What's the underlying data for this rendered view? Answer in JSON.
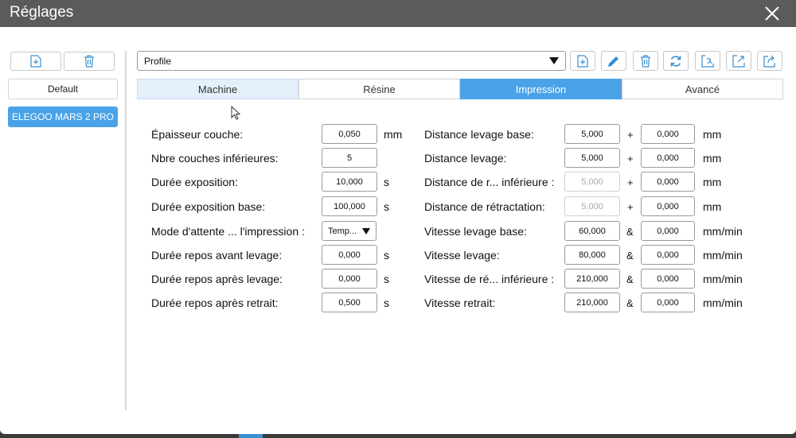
{
  "window": {
    "title": "Réglages"
  },
  "sidebar": {
    "profiles": [
      "Default",
      "ELEGOO MARS 2 PRO"
    ],
    "selected_index": 1
  },
  "toolbar": {
    "profile_value": "Profile",
    "icons": [
      "add-file-icon",
      "pencil-icon",
      "trash-icon",
      "refresh-icon",
      "import-icon",
      "export-icon",
      "export-alt-icon"
    ]
  },
  "tabs": [
    {
      "label": "Machine",
      "state": "hover"
    },
    {
      "label": "Résine",
      "state": "normal"
    },
    {
      "label": "Impression",
      "state": "active"
    },
    {
      "label": "Avancé",
      "state": "normal"
    }
  ],
  "left_form": {
    "layer_height": {
      "label": "Épaisseur couche:",
      "value": "0,050",
      "unit": "mm"
    },
    "bottom_layers": {
      "label": "Nbre couches inférieures:",
      "value": "5"
    },
    "exposure": {
      "label": "Durée exposition:",
      "value": "10,000",
      "unit": "s"
    },
    "bottom_exposure": {
      "label": "Durée exposition base:",
      "value": "100,000",
      "unit": "s"
    },
    "wait_mode": {
      "label": "Mode d'attente ... l'impression :",
      "value": "Temp..."
    },
    "wait_before_lift": {
      "label": "Durée repos avant levage:",
      "value": "0,000",
      "unit": "s"
    },
    "wait_after_lift": {
      "label": "Durée repos après levage:",
      "value": "0,000",
      "unit": "s"
    },
    "wait_after_retract": {
      "label": "Durée repos après retrait:",
      "value": "0,500",
      "unit": "s"
    }
  },
  "right_form": {
    "bottom_lift_distance": {
      "label": "Distance levage base:",
      "value": "5,000",
      "op": "+",
      "value2": "0,000",
      "unit": "mm"
    },
    "lift_distance": {
      "label": "Distance levage:",
      "value": "5,000",
      "op": "+",
      "value2": "0,000",
      "unit": "mm"
    },
    "bottom_retract_distance": {
      "label": "Distance de r... inférieure :",
      "value": "5,000",
      "op": "+",
      "value2": "0,000",
      "unit": "mm"
    },
    "retract_distance": {
      "label": "Distance de rétractation:",
      "value": "5,000",
      "op": "+",
      "value2": "0,000",
      "unit": "mm"
    },
    "bottom_lift_speed": {
      "label": "Vitesse levage base:",
      "value": "60,000",
      "op": "&",
      "value2": "0,000",
      "unit": "mm/min"
    },
    "lift_speed": {
      "label": "Vitesse levage:",
      "value": "80,000",
      "op": "&",
      "value2": "0,000",
      "unit": "mm/min"
    },
    "bottom_retract_speed": {
      "label": "Vitesse de ré... inférieure :",
      "value": "210,000",
      "op": "&",
      "value2": "0,000",
      "unit": "mm/min"
    },
    "retract_speed": {
      "label": "Vitesse retrait:",
      "value": "210,000",
      "op": "&",
      "value2": "0,000",
      "unit": "mm/min"
    }
  },
  "colors": {
    "accent": "#4aa3e8",
    "titlebar": "#5b5b5b",
    "tab_hover": "#e3effb"
  }
}
